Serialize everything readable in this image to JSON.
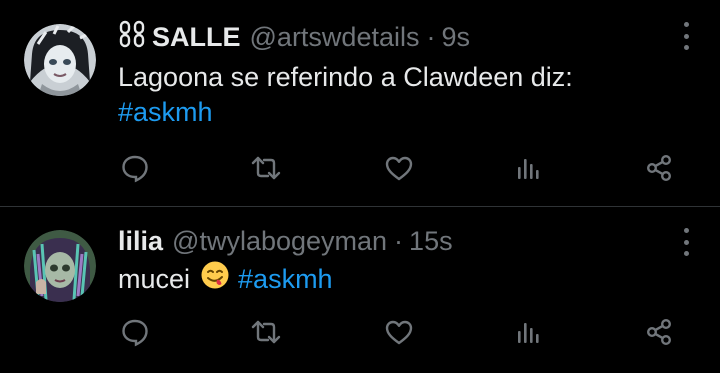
{
  "colors": {
    "background": "#000000",
    "text": "#e7e9ea",
    "muted": "#71767b",
    "hashtag": "#1d9bf0",
    "divider": "#2f3336"
  },
  "tweets": [
    {
      "display_name": "SALLE",
      "name_icon": "chain-link-icon",
      "handle": "@artswdetails",
      "separator": "·",
      "time": "9s",
      "text": "Lagoona se referindo a Clawdeen diz:",
      "hashtag": "#askmh",
      "avatar": "doll-avatar-frankie"
    },
    {
      "display_name": "lilia",
      "handle": "@twylabogeyman",
      "separator": "·",
      "time": "15s",
      "text": "mucei",
      "emoji": "face-savoring-food-emoji",
      "hashtag": "#askmh",
      "avatar": "doll-avatar-twyla"
    }
  ],
  "action_icons": [
    "reply-icon",
    "retweet-icon",
    "like-icon",
    "views-icon",
    "share-icon"
  ]
}
